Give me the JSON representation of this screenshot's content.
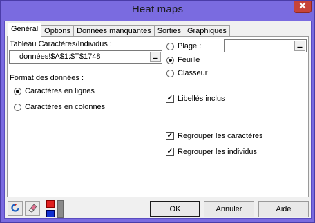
{
  "window": {
    "title": "Heat maps"
  },
  "tabs": [
    {
      "label": "Général",
      "active": true
    },
    {
      "label": "Options",
      "active": false
    },
    {
      "label": "Données manquantes",
      "active": false
    },
    {
      "label": "Sorties",
      "active": false
    },
    {
      "label": "Graphiques",
      "active": false
    }
  ],
  "general": {
    "table_label": "Tableau Caractères/Individus :",
    "table_value": "données!$A$1:$T$1748",
    "range_options": [
      {
        "label": "Plage :",
        "selected": false
      },
      {
        "label": "Feuille",
        "selected": true
      },
      {
        "label": "Classeur",
        "selected": false
      }
    ],
    "range_value": "",
    "format_label": "Format des données :",
    "format_options": [
      {
        "label": "Caractères en lignes",
        "selected": true
      },
      {
        "label": "Caractères en colonnes",
        "selected": false
      }
    ],
    "checkboxes": [
      {
        "label": "Libellés inclus",
        "checked": true
      },
      {
        "label": "Regrouper les caractères",
        "checked": true
      },
      {
        "label": "Regrouper les individus",
        "checked": true
      }
    ]
  },
  "footer": {
    "ok_label": "OK",
    "cancel_label": "Annuler",
    "help_label": "Aide"
  },
  "colors": {
    "title_bar": "#7a6be0",
    "close_button": "#c7443a",
    "dialog_bg": "#f0f0f0"
  }
}
